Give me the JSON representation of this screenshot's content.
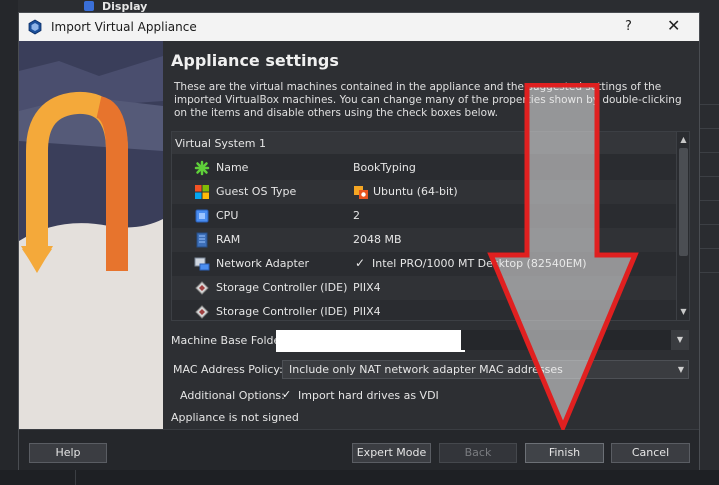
{
  "background": {
    "display_label": "Display"
  },
  "dialog": {
    "title": "Import Virtual Appliance",
    "help_glyph": "?",
    "close_glyph": "✕",
    "heading": "Appliance settings",
    "description": "These are the virtual machines contained in the appliance and the suggested settings of the imported VirtualBox machines. You can change many of the properties shown by double-clicking on the items and disable others using the check boxes below."
  },
  "tree": {
    "header": "Virtual System 1",
    "rows": [
      {
        "icon": "name-icon",
        "label": "Name",
        "value": "BookTyping"
      },
      {
        "icon": "os-type-icon",
        "label": "Guest OS Type",
        "value": "Ubuntu (64-bit)"
      },
      {
        "icon": "cpu-icon",
        "label": "CPU",
        "value": "2"
      },
      {
        "icon": "ram-icon",
        "label": "RAM",
        "value": "2048 MB"
      },
      {
        "icon": "network-icon",
        "label": "Network Adapter",
        "value": "Intel PRO/1000 MT Desktop (82540EM)",
        "checked": true
      },
      {
        "icon": "storage-icon",
        "label": "Storage Controller (IDE)",
        "value": "PIIX4"
      },
      {
        "icon": "storage-icon",
        "label": "Storage Controller (IDE)",
        "value": "PIIX4"
      }
    ]
  },
  "form": {
    "base_folder_label": "Machine Base Folder:",
    "base_folder_value": "",
    "mac_policy_label": "MAC Address Policy:",
    "mac_policy_value": "Include only NAT network adapter MAC addresses",
    "options_label": "Additional Options:",
    "import_vdi_label": "Import hard drives as VDI",
    "import_vdi_checked": true,
    "signed_status": "Appliance is not signed"
  },
  "buttons": {
    "help": "Help",
    "expert": "Expert Mode",
    "back": "Back",
    "finish": "Finish",
    "cancel": "Cancel"
  },
  "colors": {
    "annotation_arrow": "#e02020",
    "accent_orange": "#f5a623"
  }
}
